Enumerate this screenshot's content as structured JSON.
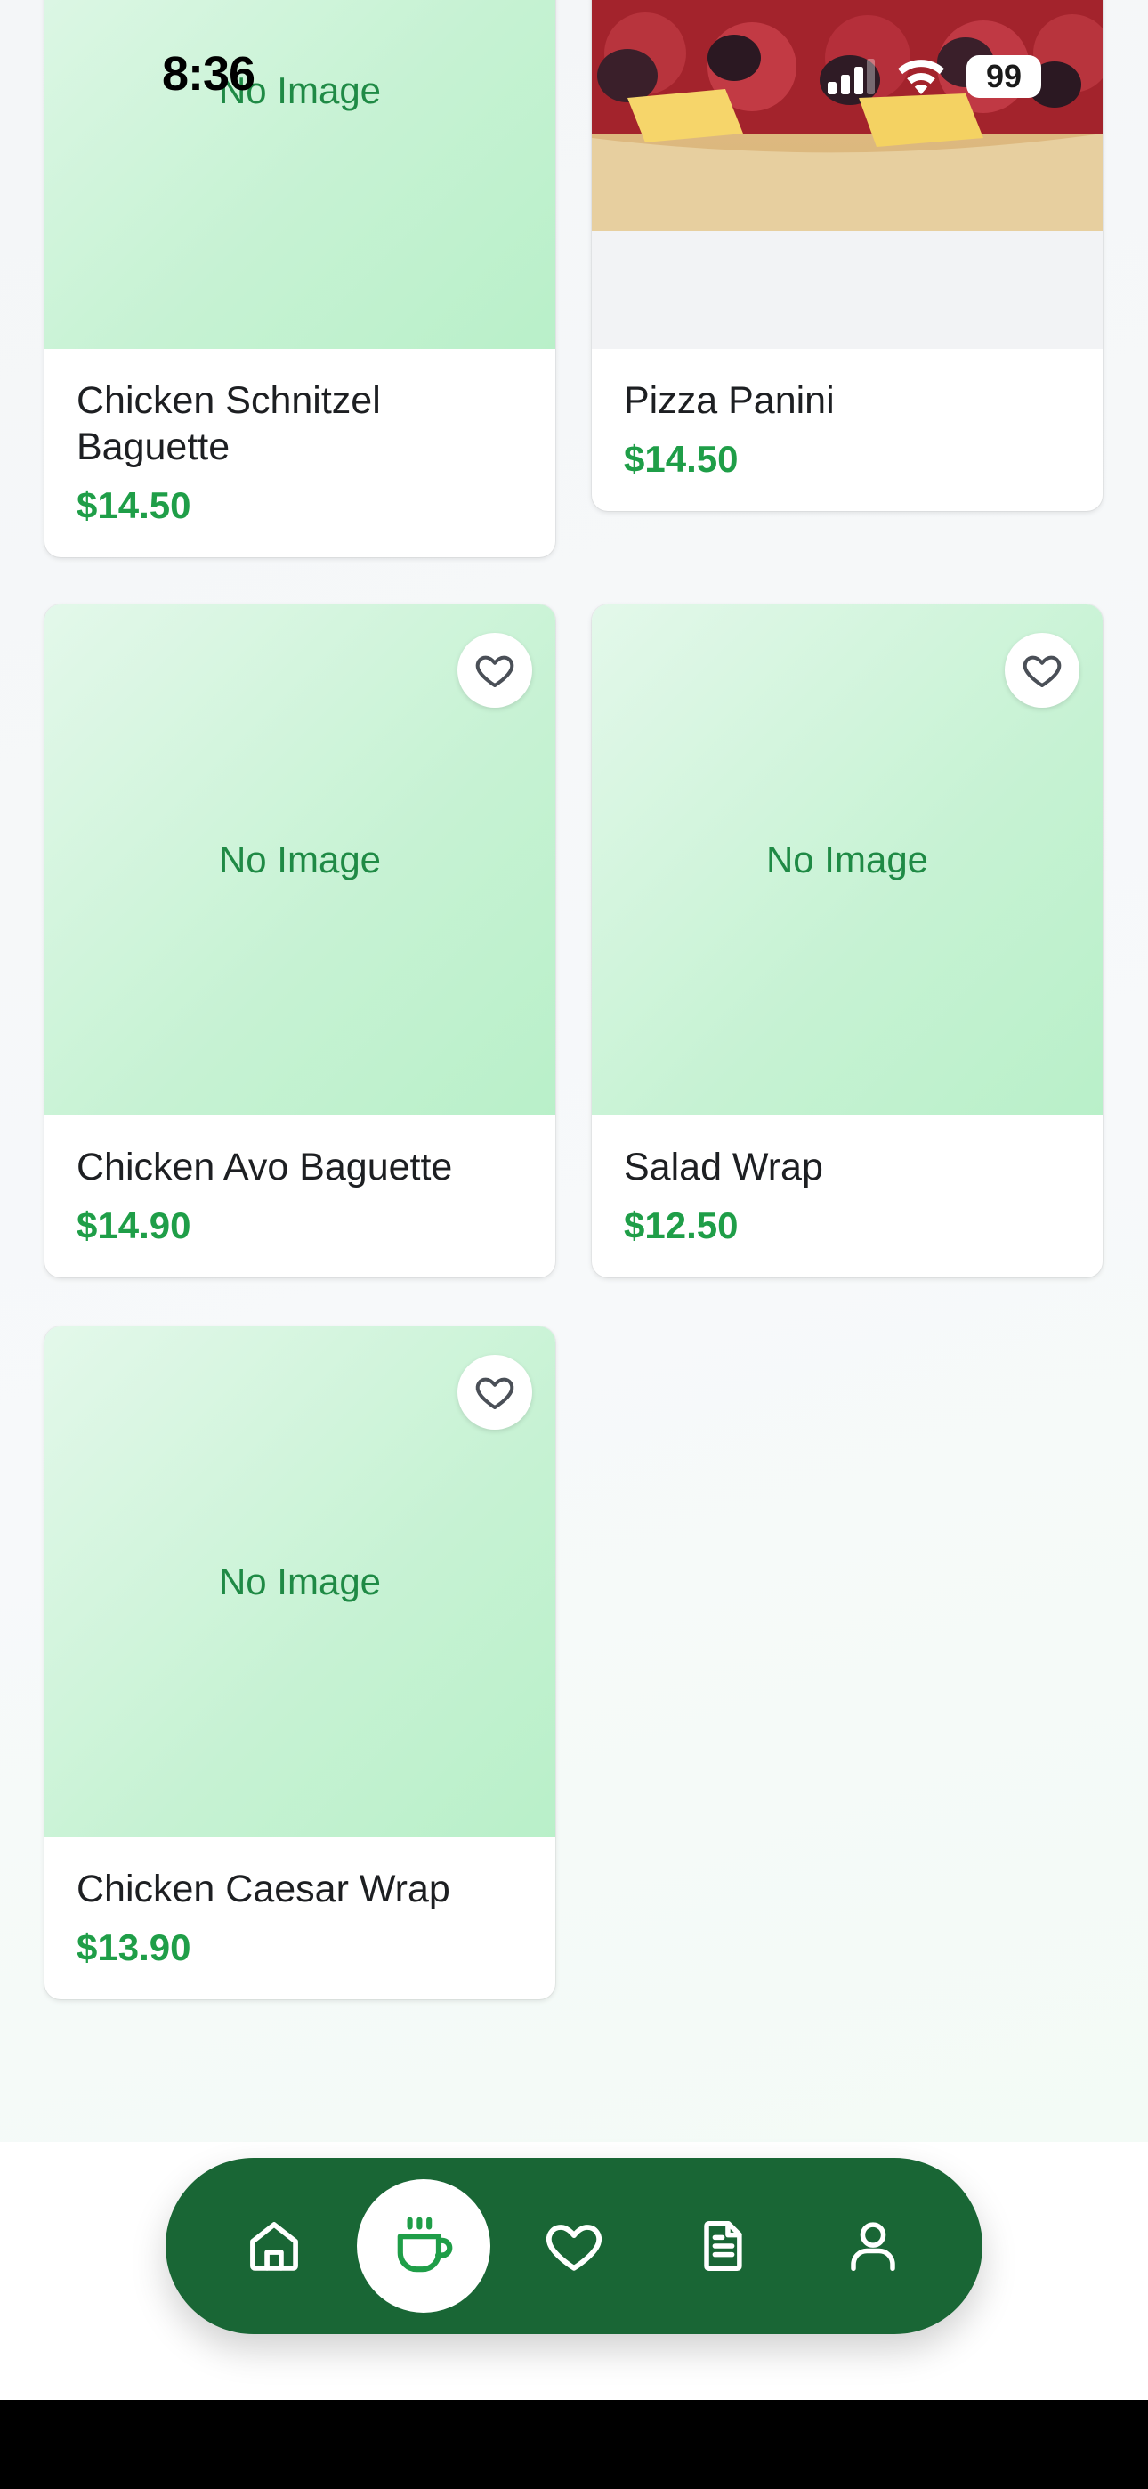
{
  "status_bar": {
    "time": "8:36",
    "battery": "99",
    "icons": [
      "signal-icon",
      "wifi-icon",
      "battery-icon"
    ]
  },
  "products": [
    {
      "name": "Chicken Schnitzel Baguette",
      "price": "$14.50",
      "image_text": "No Image"
    },
    {
      "name": "Pizza Panini",
      "price": "$14.50",
      "image_text": ""
    },
    {
      "name": "Chicken Avo Baguette",
      "price": "$14.90",
      "image_text": "No Image"
    },
    {
      "name": "Salad Wrap",
      "price": "$12.50",
      "image_text": "No Image"
    },
    {
      "name": "Chicken Caesar Wrap",
      "price": "$13.90",
      "image_text": "No Image"
    }
  ],
  "bottom_nav": {
    "items": [
      {
        "icon": "home-icon"
      },
      {
        "icon": "coffee-cup-icon",
        "active": true
      },
      {
        "icon": "heart-icon"
      },
      {
        "icon": "document-icon"
      },
      {
        "icon": "user-icon"
      }
    ]
  },
  "colors": {
    "brand_green": "#196635",
    "price_green": "#1f9e48",
    "placeholder_text": "#1f8a45"
  }
}
